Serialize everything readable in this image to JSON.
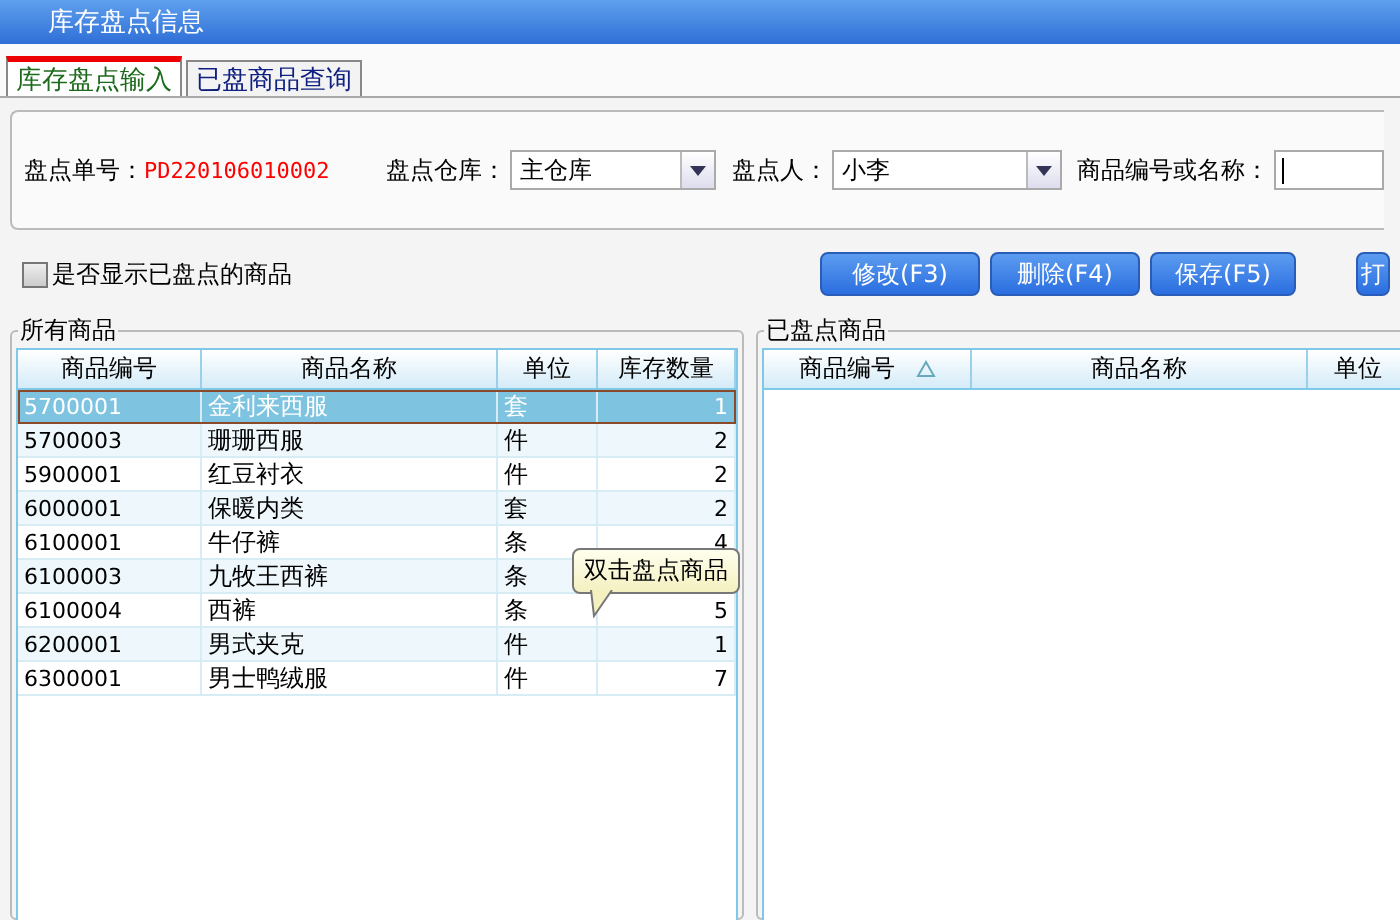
{
  "window": {
    "title": "库存盘点信息"
  },
  "tabs": [
    {
      "label": "库存盘点输入",
      "selected": true
    },
    {
      "label": "已盘商品查询",
      "selected": false
    }
  ],
  "form": {
    "order_no": {
      "label": "盘点单号：",
      "value": "PD220106010002"
    },
    "warehouse": {
      "label": "盘点仓库：",
      "value": "主仓库"
    },
    "counter": {
      "label": "盘点人：",
      "value": "小李"
    },
    "search": {
      "label": "商品编号或名称："
    }
  },
  "show_counted": {
    "label": "是否显示已盘点的商品",
    "checked": false
  },
  "buttons": [
    "修改(F3)",
    "删除(F4)",
    "保存(F5)",
    "打"
  ],
  "all_goods": {
    "title": "所有商品",
    "columns": [
      "商品编号",
      "商品名称",
      "单位",
      "库存数量"
    ],
    "rows": [
      {
        "cells": [
          "5700001",
          "金利来西服",
          "套",
          "1"
        ],
        "selected": true
      },
      {
        "cells": [
          "5700003",
          "珊珊西服",
          "件",
          "2"
        ],
        "selected": false
      },
      {
        "cells": [
          "5900001",
          "红豆衬衣",
          "件",
          "2"
        ],
        "selected": false
      },
      {
        "cells": [
          "6000001",
          "保暖内类",
          "套",
          "2"
        ],
        "selected": false
      },
      {
        "cells": [
          "6100001",
          "牛仔裤",
          "条",
          "4"
        ],
        "selected": false
      },
      {
        "cells": [
          "6100003",
          "九牧王西裤",
          "条"
        ],
        "selected": false
      },
      {
        "cells": [
          "6100004",
          "西裤",
          "条",
          "5"
        ],
        "selected": false
      },
      {
        "cells": [
          "6200001",
          "男式夹克",
          "件",
          "1"
        ],
        "selected": false
      },
      {
        "cells": [
          "6300001",
          "男士鸭绒服",
          "件",
          "7"
        ],
        "selected": false
      }
    ]
  },
  "tooltip": "双击盘点商品",
  "counted_goods": {
    "title": "已盘点商品",
    "columns": [
      {
        "label": "商品编号",
        "sorted": true
      },
      {
        "label": "商品名称",
        "sorted": false
      },
      {
        "label": "单位",
        "sorted": false
      }
    ]
  }
}
